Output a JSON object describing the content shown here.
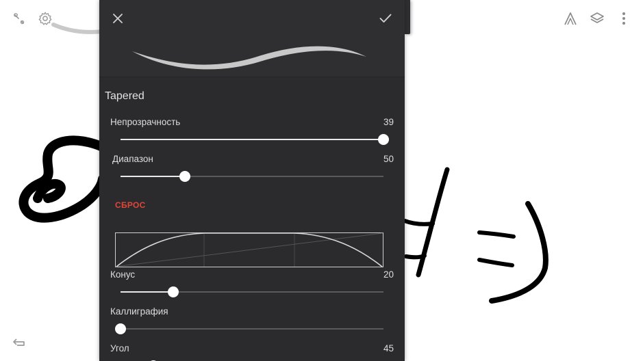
{
  "editor": {
    "preset_name": "Tapered",
    "sliders": [
      {
        "id": "opacity",
        "label": "Непрозрачность",
        "value": "39",
        "fraction": 1.0
      },
      {
        "id": "range",
        "label": "Диапазон",
        "value": "50",
        "fraction": 0.245
      },
      {
        "id": "taper",
        "label": "Конус",
        "value": "20",
        "fraction": 0.2
      },
      {
        "id": "calligraphy",
        "label": "Каллиграфия",
        "value": "",
        "fraction": 0.0
      },
      {
        "id": "angle",
        "label": "Угол",
        "value": "45",
        "fraction": 0.125
      }
    ],
    "reset_label": "СБРОС"
  },
  "colors": {
    "panel_bg": "#2b2b2d",
    "accent_reset": "#e0463a",
    "slider_fill": "#e8e8e8",
    "slider_track": "#5a5a5c",
    "canvas_bg": "#ffffff",
    "ink": "#000000"
  },
  "icons": {
    "close": "close-icon",
    "confirm": "check-icon",
    "settings": "gear-icon",
    "tool_top_left": "eyedropper-icon",
    "perspective": "perspective-icon",
    "layers": "layers-icon",
    "more": "more-vertical-icon",
    "undo": "undo-icon"
  }
}
